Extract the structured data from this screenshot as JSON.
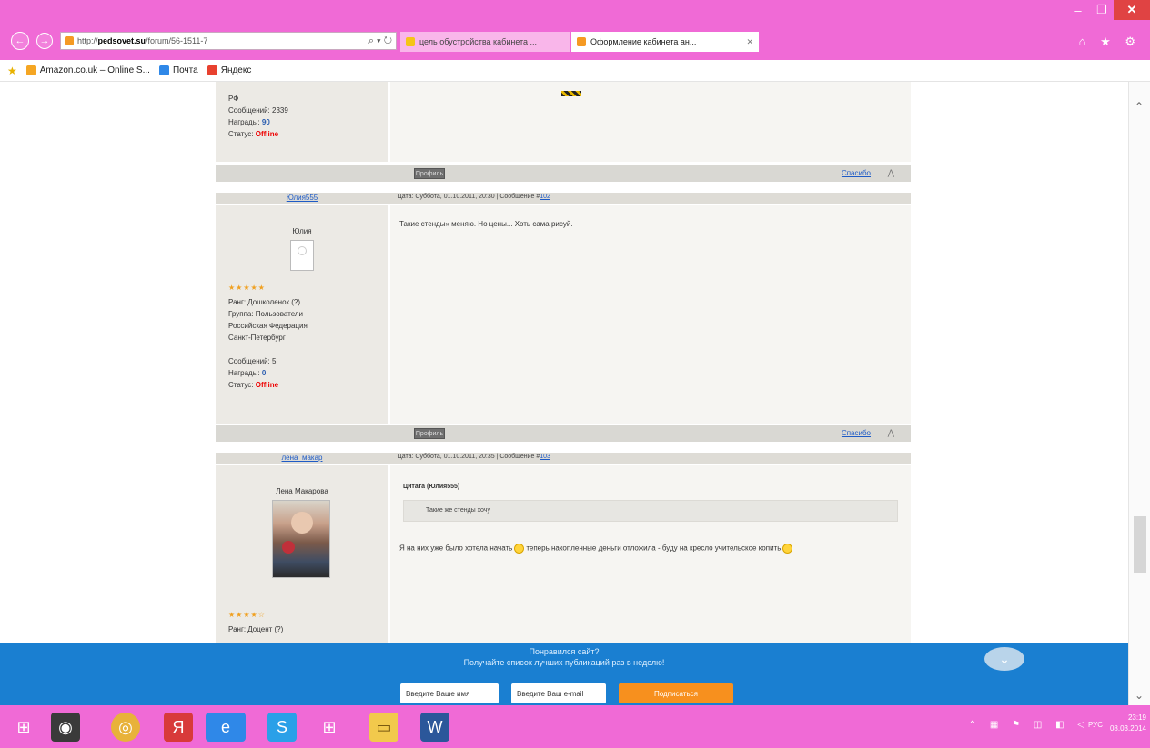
{
  "browser": {
    "window_controls": [
      "–",
      "❐",
      "✕"
    ],
    "address": {
      "prefix": "http://",
      "host": "pedsovet.su",
      "path": "/forum/56-1511-7",
      "tools": "⌕ ▾ ↻"
    },
    "tabs": [
      {
        "label": "цель обустройства кабинета ...",
        "active": false,
        "icon_color": "#f5c518"
      },
      {
        "label": "Оформление кабинета ан...",
        "active": true,
        "icon_color": "#f59a23"
      }
    ],
    "right_icons": "⌂ ★ ⚙"
  },
  "favorites": [
    {
      "label": "Amazon.co.uk – Online S...",
      "icon": "amazon-icon",
      "color": "#f5a623"
    },
    {
      "label": "Почта",
      "icon": "mail-icon",
      "color": "#2f88e8"
    },
    {
      "label": "Яндекс",
      "icon": "yandex-icon",
      "color": "#e8412f"
    }
  ],
  "posts": [
    {
      "partial": true,
      "info_lines": [
        "РФ",
        "Сообщений: 2339",
        "Награды:",
        "Статус:"
      ],
      "awards_value": "90",
      "status_value": "Offline",
      "bar": {
        "profile": "Профиль",
        "thanks": "Спасибо",
        "up": "⋀"
      }
    },
    {
      "nick": "Юлия555",
      "date": "Дата: Суббота, 01.10.2011, 20:30 | Сообщение #",
      "num": "102",
      "name": "Юлия",
      "stars": "★★★★★",
      "info_lines": [
        "Ранг: Дошколенок",
        "Группа: Пользователи",
        "Российская Федерация",
        "Санкт-Петербург",
        "",
        "Сообщений: 5",
        "Награды:",
        "Статус:"
      ],
      "rank_help": "(?)",
      "awards_value": "0",
      "status_value": "Offline",
      "text": "Такие стенды» меняю. Но цены... Хоть сама рисуй.",
      "bar": {
        "profile": "Профиль",
        "thanks": "Спасибо",
        "up": "⋀"
      }
    },
    {
      "nick": "лена_макар",
      "date": "Дата: Суббота, 01.10.2011, 20:35 | Сообщение #",
      "num": "103",
      "name": "Лена Макарова",
      "stars": "★★★★☆",
      "info_lines": [
        "Ранг: Доцент"
      ],
      "rank_help": "(?)",
      "quote_head": "Цитата (Юлия555)",
      "quote_text": "Такие же стенды хочу",
      "text_a": "Я на них уже было хотела начать",
      "text_b": "теперь накопленные деньги отложила - буду на кресло учительское копить"
    }
  ],
  "subscribe": {
    "title": "Понравился сайт?",
    "subtitle": "Получайте список лучших публикаций раз в неделю!",
    "name_placeholder": "Введите Ваше имя",
    "email_placeholder": "Введите Ваш e-mail",
    "button": "Подписаться",
    "collapse": "⌄"
  },
  "taskbar": {
    "apps": [
      {
        "name": "start",
        "glyph": "⊞",
        "bg": "transparent"
      },
      {
        "name": "webcam",
        "glyph": "◉",
        "bg": "#3a3a3a"
      },
      {
        "name": "chrome",
        "glyph": "◎",
        "bg": "#e8b23a"
      },
      {
        "name": "yandex",
        "glyph": "Я",
        "bg": "#d83a3a"
      },
      {
        "name": "ie",
        "glyph": "e",
        "bg": "#2f88e8"
      },
      {
        "name": "skype",
        "glyph": "S",
        "bg": "#2aa0e8"
      },
      {
        "name": "store",
        "glyph": "⊞",
        "bg": "transparent"
      },
      {
        "name": "explorer",
        "glyph": "▭",
        "bg": "#f2c94c"
      },
      {
        "name": "word",
        "glyph": "W",
        "bg": "#2b579a"
      }
    ],
    "tray": "⌃ ▦ ⚑ ◫ ◧ ◁",
    "lang": "РУС",
    "time": "23:19",
    "date": "08.03.2014"
  }
}
